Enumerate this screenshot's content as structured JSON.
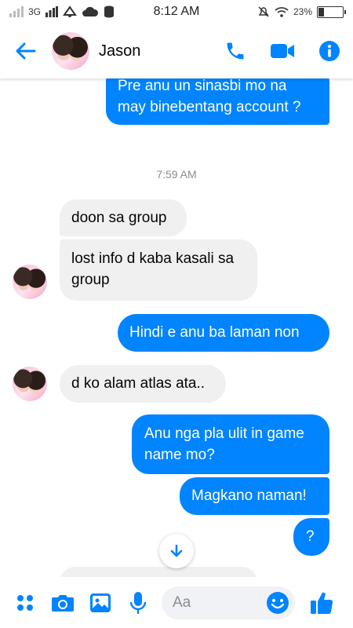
{
  "status_bar": {
    "network": "3G",
    "time": "8:12 AM",
    "battery": "23%",
    "battery_level": 0.23
  },
  "header": {
    "contact_name": "Jason"
  },
  "colors": {
    "accent": "#0084ff",
    "incoming_bubble": "#f0f0f0"
  },
  "conversation": {
    "timestamp": "7:59 AM",
    "messages": [
      {
        "direction": "out",
        "text": "Pre anu un sinasbi mo na may binebentang account ?"
      },
      {
        "direction": "in",
        "text": "doon sa group"
      },
      {
        "direction": "in",
        "text": "lost info d kaba kasali sa group"
      },
      {
        "direction": "out",
        "text": "Hindi e anu ba laman  non"
      },
      {
        "direction": "in",
        "text": "d ko alam atlas ata.."
      },
      {
        "direction": "out",
        "text": "Anu nga pla ulit in game name mo?"
      },
      {
        "direction": "out",
        "text": "Magkano naman!"
      },
      {
        "direction": "out",
        "text": "?"
      }
    ]
  },
  "composer": {
    "placeholder": "Aa"
  },
  "icons": [
    "back-arrow-icon",
    "phone-icon",
    "video-icon",
    "info-icon",
    "apps-icon",
    "camera-icon",
    "gallery-icon",
    "mic-icon",
    "emoji-icon",
    "like-icon",
    "scroll-down-icon"
  ]
}
